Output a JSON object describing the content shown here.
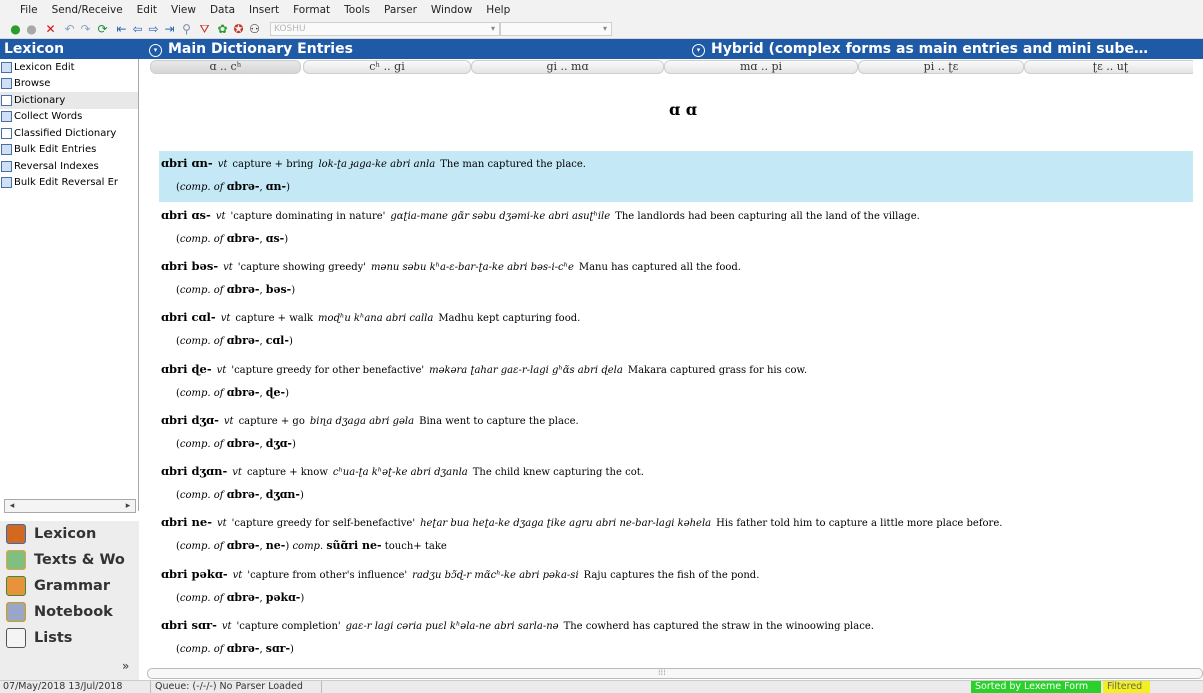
{
  "menu": [
    "File",
    "Send/Receive",
    "Edit",
    "View",
    "Data",
    "Insert",
    "Format",
    "Tools",
    "Parser",
    "Window",
    "Help"
  ],
  "toolbar": {
    "writing_system_combo": "KOSHU",
    "style_combo": ""
  },
  "left_pane": {
    "title": "Lexicon",
    "items": [
      {
        "label": "Lexicon Edit",
        "selected": false
      },
      {
        "label": "Browse",
        "selected": false
      },
      {
        "label": "Dictionary",
        "selected": true
      },
      {
        "label": "Collect Words",
        "selected": false
      },
      {
        "label": "Classified Dictionary",
        "selected": false
      },
      {
        "label": "Bulk Edit Entries",
        "selected": false
      },
      {
        "label": "Reversal Indexes",
        "selected": false
      },
      {
        "label": "Bulk Edit Reversal Er",
        "selected": false
      }
    ],
    "areas": [
      {
        "label": "Lexicon",
        "icon": "lexicon-cube-icon"
      },
      {
        "label": "Texts & Wo",
        "icon": "texts-cube-icon"
      },
      {
        "label": "Grammar",
        "icon": "grammar-blocks-icon"
      },
      {
        "label": "Notebook",
        "icon": "notebook-gear-icon"
      },
      {
        "label": "Lists",
        "icon": "lists-icon"
      }
    ]
  },
  "main": {
    "title": "Main Dictionary Entries",
    "config_title": "Hybrid (complex forms as main entries and mini sube…",
    "index_tabs": [
      "ɑ .. cʰ",
      "cʰ .. gi",
      "gi .. mɑ",
      "mɑ .. pi",
      "pi .. ʈɛ",
      "ʈɛ .. uʈ"
    ],
    "letter_heading": "ɑ ɑ",
    "entries": [
      {
        "headword": "ɑbri ɑn-",
        "pos": "vt",
        "gloss": "capture + bring",
        "example": "lok-ʈa ɟaga-ke abri anla",
        "translation": "The man captured the place.",
        "comp_of": "comp. of",
        "comp_a": "ɑbrə-",
        "comp_b": "ɑn-"
      },
      {
        "headword": "ɑbri ɑs-",
        "pos": "vt",
        "gloss": "'capture dominating in nature'",
        "example": "gɑʈia-mane gɑ̃r səbu dʒəmi-ke abri asuʈʰile",
        "translation": "The landlords had been capturing all the land of the village.",
        "comp_of": "comp. of",
        "comp_a": "ɑbrə-",
        "comp_b": "ɑs-"
      },
      {
        "headword": "ɑbri bəs-",
        "pos": "vt",
        "gloss": "'capture showing greedy'",
        "example": "mənu səbu kʰa-ɛ-bar-ʈa-ke abri bəs-i-cʰe",
        "translation": "Manu has captured all the food.",
        "comp_of": "comp. of",
        "comp_a": "ɑbrə-",
        "comp_b": "bəs-"
      },
      {
        "headword": "ɑbri cɑl-",
        "pos": "vt",
        "gloss": "capture + walk",
        "example": "moɖʰu kʰana abri calla",
        "translation": "Madhu kept capturing food.",
        "comp_of": "comp. of",
        "comp_a": "ɑbrə-",
        "comp_b": "cɑl-"
      },
      {
        "headword": "ɑbri ɖe-",
        "pos": "vt",
        "gloss": "'capture greedy for other benefactive'",
        "example": "məkəra ʈahar gaɛ-r-lagi gʰɑ̃s abri ɖela",
        "translation": "Makara captured grass for his cow.",
        "comp_of": "comp. of",
        "comp_a": "ɑbrə-",
        "comp_b": "ɖe-"
      },
      {
        "headword": "ɑbri dʒɑ-",
        "pos": "vt",
        "gloss": "capture + go",
        "example": "biɳa dʒaga abri gəla",
        "translation": "Bina went to capture the place.",
        "comp_of": "comp. of",
        "comp_a": "ɑbrə-",
        "comp_b": "dʒɑ-"
      },
      {
        "headword": "ɑbri dʒɑn-",
        "pos": "vt",
        "gloss": "capture + know",
        "example": "cʰua-ʈa kʰəʈ-ke abri dʒanla",
        "translation": "The child knew capturing the cot.",
        "comp_of": "comp. of",
        "comp_a": "ɑbrə-",
        "comp_b": "dʒɑn-"
      },
      {
        "headword": "ɑbri ne-",
        "pos": "vt",
        "gloss": "'capture greedy for self-benefactive'",
        "example": "heʈar bua heʈa-ke dʒaga ʈike agru abri ne-bar-lagi kəhela",
        "translation": "His father told him to capture a little more place before.",
        "comp_of": "comp. of",
        "comp_a": "ɑbrə-",
        "comp_b": "ne-",
        "extra_label": "comp.",
        "extra_word": "sũɑ̃ri ne-",
        "extra_gloss": "touch+ take"
      },
      {
        "headword": "ɑbri pəkɑ-",
        "pos": "vt",
        "gloss": "'capture from other's influence'",
        "example": "radʒu bɔ̃ɖ-r mɑ̃cʰ-ke abri pəka-si",
        "translation": "Raju captures the fish of the pond.",
        "comp_of": "comp. of",
        "comp_a": "ɑbrə-",
        "comp_b": "pəkɑ-"
      },
      {
        "headword": "ɑbri sɑr-",
        "pos": "vt",
        "gloss": "'capture completion'",
        "example": "gaɛ-r lagi cəria puɛl kʰəla-ne abri sarla-nə",
        "translation": "The cowherd has captured the straw in the winoowing place.",
        "comp_of": "comp. of",
        "comp_a": "ɑbrə-",
        "comp_b": "sɑr-"
      }
    ]
  },
  "status": {
    "dates": "07/May/2018 13/Jul/2018",
    "queue": "Queue: (-/-/-) No Parser Loaded",
    "sort": "Sorted by Lexeme Form",
    "filter": "Filtered",
    "sort_color": "#2bd12b",
    "filter_color": "#f3f020"
  },
  "colors": {
    "header_blue": "#1f5aa6",
    "highlight": "#c5e8f6"
  }
}
